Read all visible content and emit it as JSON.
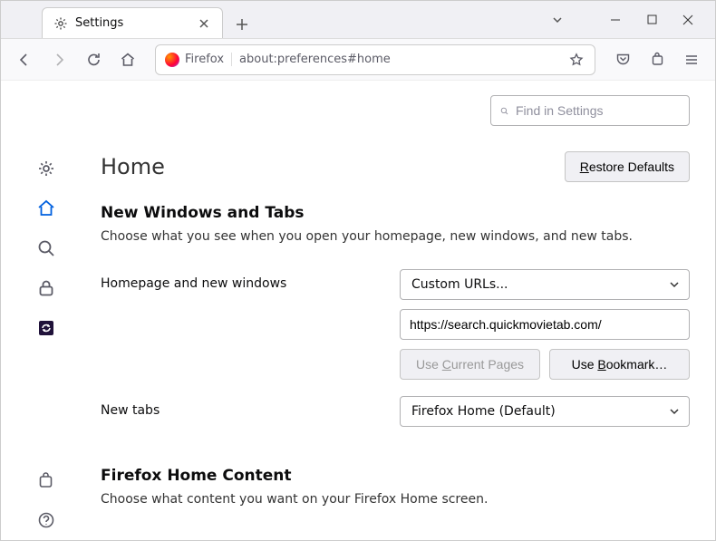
{
  "window": {
    "tab_title": "Settings",
    "identity_label": "Firefox",
    "url": "about:preferences#home"
  },
  "searchbox": {
    "placeholder": "Find in Settings"
  },
  "page": {
    "title": "Home",
    "restore_button": "Restore Defaults"
  },
  "section1": {
    "title": "New Windows and Tabs",
    "desc": "Choose what you see when you open your homepage, new windows, and new tabs.",
    "homepage_label": "Homepage and new windows",
    "homepage_select": "Custom URLs...",
    "homepage_url": "https://search.quickmovietab.com/",
    "use_current_prefix": "Use ",
    "use_current_key": "C",
    "use_current_suffix": "urrent Pages",
    "use_bookmark_prefix": "Use ",
    "use_bookmark_key": "B",
    "use_bookmark_suffix": "ookmark…",
    "newtabs_label": "New tabs",
    "newtabs_select": "Firefox Home (Default)"
  },
  "section2": {
    "title": "Firefox Home Content",
    "desc": "Choose what content you want on your Firefox Home screen."
  },
  "restore_key": "R",
  "restore_suffix": "estore Defaults"
}
